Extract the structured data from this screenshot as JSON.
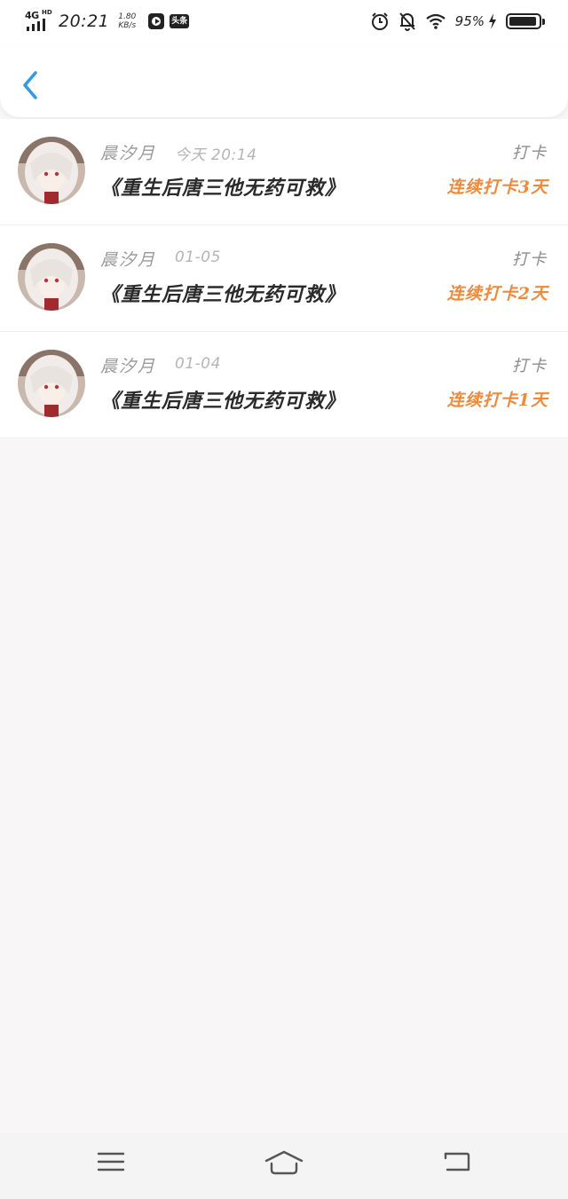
{
  "status_bar": {
    "network_type": "4G",
    "network_hd": "HD",
    "time": "20:21",
    "speed_value": "1.80",
    "speed_unit": "KB/s",
    "app_badge": "头条",
    "battery_percent": "95%",
    "icons": [
      "signal-icon",
      "video-app-icon",
      "alarm-icon",
      "mute-bell-icon",
      "wifi-icon",
      "charging-icon",
      "battery-icon"
    ]
  },
  "header": {
    "back_icon": "chevron-left-icon",
    "accent_color": "#2f9be4"
  },
  "checkins": [
    {
      "user": "晨汐月",
      "date": "今天 20:14",
      "type": "打卡",
      "title": "《重生后唐三他无药可救》",
      "streak": "连续打卡3天"
    },
    {
      "user": "晨汐月",
      "date": "01-05",
      "type": "打卡",
      "title": "《重生后唐三他无药可救》",
      "streak": "连续打卡2天"
    },
    {
      "user": "晨汐月",
      "date": "01-04",
      "type": "打卡",
      "title": "《重生后唐三他无药可救》",
      "streak": "连续打卡1天"
    }
  ],
  "colors": {
    "streak": "#f08a3a",
    "background": "#f8f6f6"
  },
  "bottom_nav": {
    "icons": [
      "menu-icon",
      "home-icon",
      "back-nav-icon"
    ]
  }
}
